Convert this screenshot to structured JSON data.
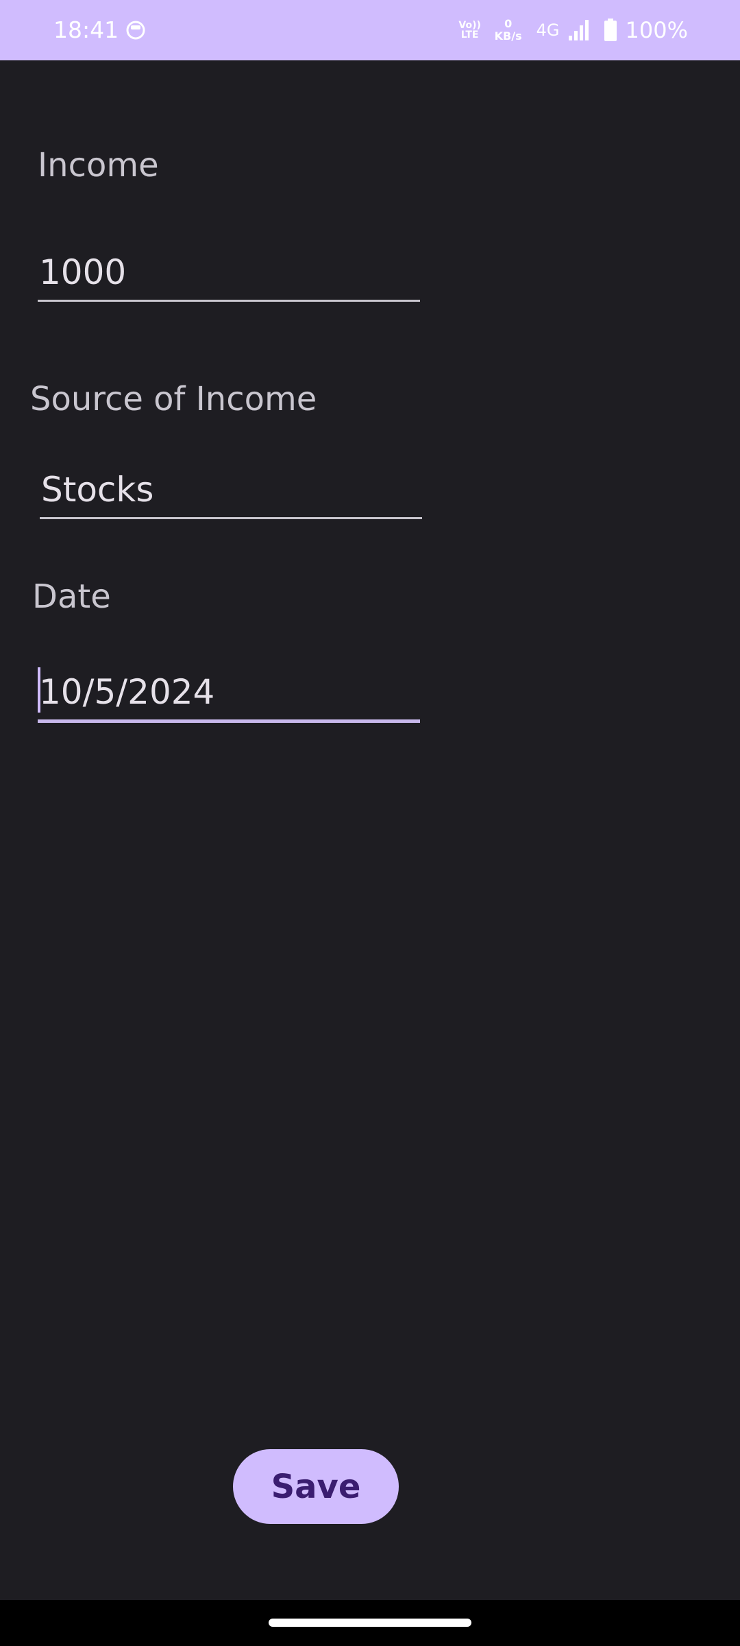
{
  "status_bar": {
    "time": "18:41",
    "app_icon": "notification-circle-icon",
    "volte_top": "Vo))",
    "volte_bottom": "LTE",
    "net_speed_value": "0",
    "net_speed_unit": "KB/s",
    "network_type": "4G",
    "signal_icon": "signal-icon",
    "battery_icon": "battery-icon",
    "battery_percent": "100%"
  },
  "form": {
    "income": {
      "label": "Income",
      "value": "1000"
    },
    "source": {
      "label": "Source of Income",
      "value": "Stocks"
    },
    "date": {
      "label": "Date",
      "value": "10/5/2024"
    }
  },
  "actions": {
    "save_label": "Save"
  },
  "colors": {
    "background": "#1e1d22",
    "accent": "#d0bcfe",
    "button_text": "#3a1d70",
    "label_text": "#c9c6cf"
  }
}
